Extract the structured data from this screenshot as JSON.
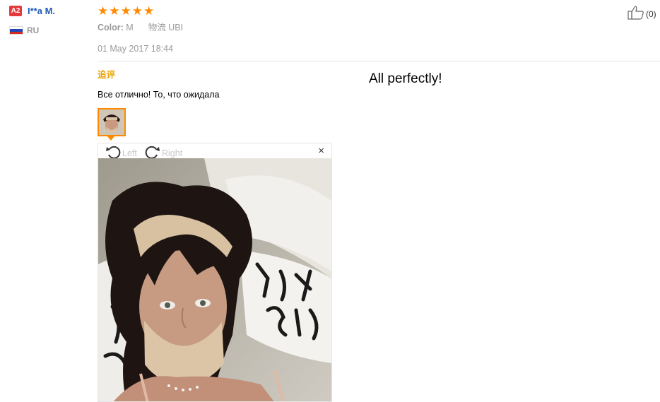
{
  "reviewer": {
    "level_badge": "A2",
    "name": "I**a M.",
    "country": "RU"
  },
  "rating": {
    "stars": 5,
    "max": 5,
    "star_glyph": "★",
    "color": "#ff8a00"
  },
  "order_info": {
    "color_label": "Color:",
    "color_value": "M",
    "logistics_label": "物流",
    "logistics_value": "UBI"
  },
  "review_date": "01 May 2017 18:44",
  "helpful": {
    "count": "(0)"
  },
  "followup": {
    "title": "追评",
    "text": "Все отлично! То, что ожидала",
    "translation": "All perfectly!"
  },
  "image_viewer": {
    "rotate_left": "Left",
    "rotate_right": "Right",
    "close": "×"
  },
  "colors": {
    "accent_orange": "#ff8a00",
    "name_blue": "#1f5ab5",
    "followup_gold": "#e8a200",
    "badge_red": "#e4393c"
  }
}
